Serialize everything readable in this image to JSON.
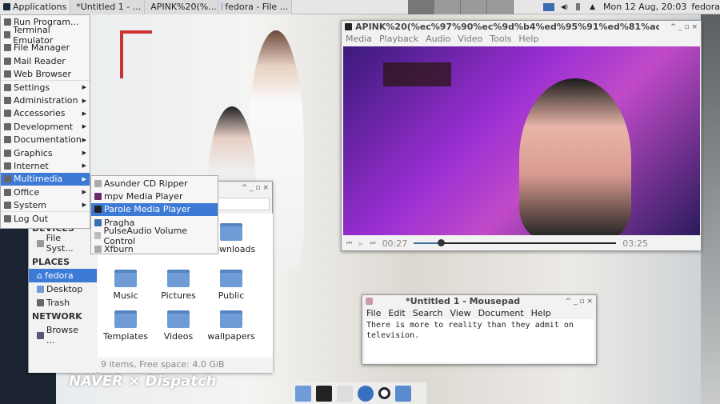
{
  "panel": {
    "applications": "Applications",
    "tasks": [
      "*Untitled 1 - ...",
      "APINK%20(%...",
      "fedora - File ..."
    ],
    "clock": "Mon 12 Aug, 20:03",
    "user": "fedora"
  },
  "menu": {
    "items": [
      {
        "label": "Run Program...",
        "submenu": false
      },
      {
        "label": "Terminal Emulator",
        "submenu": false
      },
      {
        "label": "File Manager",
        "submenu": false
      },
      {
        "label": "Mail Reader",
        "submenu": false
      },
      {
        "label": "Web Browser",
        "submenu": false
      },
      {
        "label": "Settings",
        "submenu": true
      },
      {
        "label": "Administration",
        "submenu": true
      },
      {
        "label": "Accessories",
        "submenu": true
      },
      {
        "label": "Development",
        "submenu": true
      },
      {
        "label": "Documentation",
        "submenu": true
      },
      {
        "label": "Graphics",
        "submenu": true
      },
      {
        "label": "Internet",
        "submenu": true
      },
      {
        "label": "Multimedia",
        "submenu": true,
        "selected": true
      },
      {
        "label": "Office",
        "submenu": true
      },
      {
        "label": "System",
        "submenu": true
      },
      {
        "label": "Log Out",
        "submenu": false
      }
    ],
    "multimedia": [
      "Asunder CD Ripper",
      "mpv Media Player",
      "Parole Media Player",
      "Pragha",
      "PulseAudio Volume Control",
      "Xfburn"
    ],
    "multimedia_selected": "Parole Media Player"
  },
  "file_manager": {
    "sidebar": {
      "devices_header": "DEVICES",
      "devices": [
        "File Syst..."
      ],
      "places_header": "PLACES",
      "places": [
        "fedora",
        "Desktop",
        "Trash"
      ],
      "selected": "fedora",
      "network_header": "NETWORK",
      "network": [
        "Browse ..."
      ]
    },
    "items": [
      "Desktop",
      "Documents",
      "Downloads",
      "Music",
      "Pictures",
      "Public",
      "Templates",
      "Videos",
      "wallpapers"
    ],
    "status": "9 items, Free space: 4.0 GiB"
  },
  "parole": {
    "title": "APINK%20(%ec%97%90%ec%9d%b4%ed%95%91%ed%81%ac)%20-%20I'M",
    "menu": [
      "Media",
      "Playback",
      "Audio",
      "Video",
      "Tools",
      "Help"
    ],
    "elapsed": "00:27",
    "duration": "03:25",
    "progress": 0.132
  },
  "mousepad": {
    "title": "*Untitled 1 - Mousepad",
    "menu": [
      "File",
      "Edit",
      "Search",
      "View",
      "Document",
      "Help"
    ],
    "content": "There is more to reality than they admit on\ntelevision."
  },
  "dock": [
    "file-manager-icon",
    "terminal-icon",
    "file-cabinet-icon",
    "web-browser-icon",
    "search-icon",
    "folder-icon"
  ],
  "watermark": "NAVER × Dispatch"
}
